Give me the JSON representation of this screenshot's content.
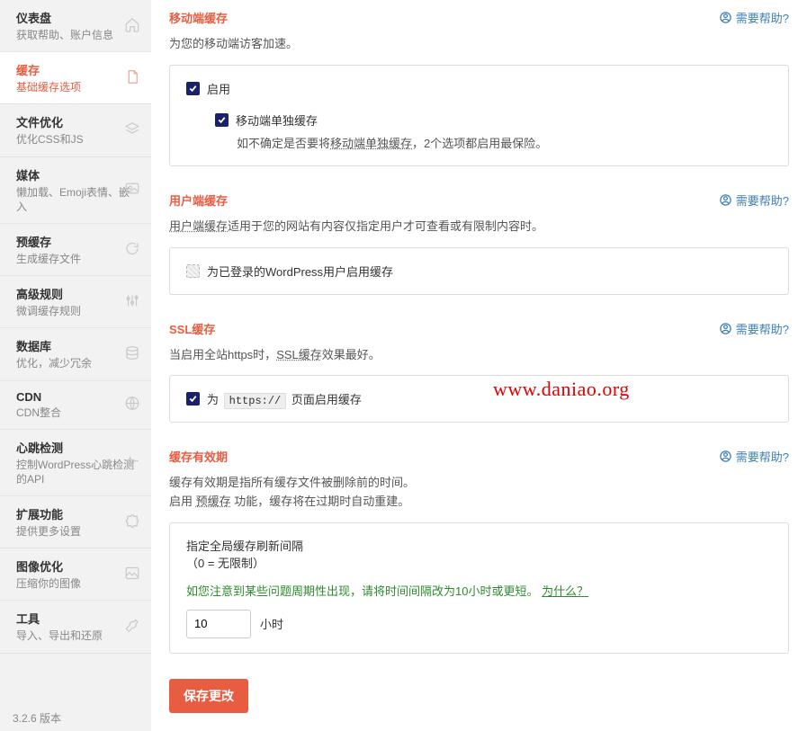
{
  "sidebar": {
    "items": [
      {
        "title": "仪表盘",
        "sub": "获取帮助、账户信息",
        "icon": "home"
      },
      {
        "title": "缓存",
        "sub": "基础缓存选项",
        "icon": "doc",
        "active": true
      },
      {
        "title": "文件优化",
        "sub": "优化CSS和JS",
        "icon": "layers"
      },
      {
        "title": "媒体",
        "sub": "懒加载、Emoji表情、嵌入",
        "icon": "image"
      },
      {
        "title": "预缓存",
        "sub": "生成缓存文件",
        "icon": "refresh"
      },
      {
        "title": "高级规则",
        "sub": "微调缓存规则",
        "icon": "sliders"
      },
      {
        "title": "数据库",
        "sub": "优化，减少冗余",
        "icon": "db"
      },
      {
        "title": "CDN",
        "sub": "CDN整合",
        "icon": "globe"
      },
      {
        "title": "心跳检测",
        "sub": "控制WordPress心跳检测的API",
        "icon": "heart"
      },
      {
        "title": "扩展功能",
        "sub": "提供更多设置",
        "icon": "puzzle"
      },
      {
        "title": "图像优化",
        "sub": "压缩你的图像",
        "icon": "picture"
      },
      {
        "title": "工具",
        "sub": "导入、导出和还原",
        "icon": "wrench"
      }
    ],
    "version": "3.2.6 版本"
  },
  "help_label": "需要帮助?",
  "sections": {
    "mobile": {
      "title": "移动端缓存",
      "desc": "为您的移动端访客加速。",
      "enable_label": "启用",
      "separate_label": "移动端单独缓存",
      "hint_a": "如不确定是否要将",
      "hint_link": "移动端单独缓存",
      "hint_b": "，2个选项都启用最保险。"
    },
    "user": {
      "title": "用户端缓存",
      "desc_link": "用户端缓存",
      "desc_rest": "适用于您的网站有内容仅指定用户才可查看或有限制内容时。",
      "check_label": "为已登录的WordPress用户启用缓存"
    },
    "ssl": {
      "title": "SSL缓存",
      "desc_a": "当启用全站https时，",
      "desc_link": "SSL缓存",
      "desc_b": "效果最好。",
      "check_prefix": "为",
      "code": "https://",
      "check_suffix": "页面启用缓存"
    },
    "lifespan": {
      "title": "缓存有效期",
      "desc_line1": "缓存有效期是指所有缓存文件被删除前的时间。",
      "desc_line2a": "启用 ",
      "desc_line2_link": "预缓存",
      "desc_line2b": " 功能，缓存将在过期时自动重建。",
      "box_label_line1": "指定全局缓存刷新间隔",
      "box_label_line2": "（0 = 无限制）",
      "green": "如您注意到某些问题周期性出现，请将时间间隔改为10小时或更短。",
      "green_link": "为什么？",
      "value": "10",
      "unit": "小时"
    }
  },
  "save_label": "保存更改",
  "watermark": "www.daniao.org"
}
